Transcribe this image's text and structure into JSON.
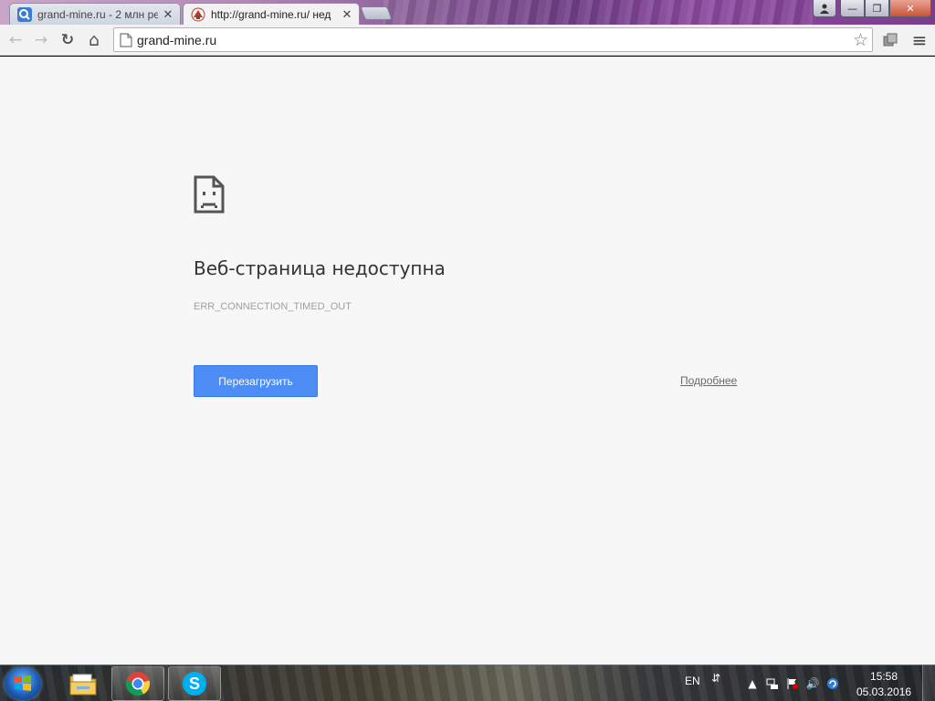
{
  "browser": {
    "tabs": [
      {
        "title": "grand-mine.ru - 2 млн рез",
        "close_label": "✕",
        "favicon": "search-icon",
        "active": false
      },
      {
        "title": "http://grand-mine.ru/ нед",
        "close_label": "✕",
        "favicon": "site-favicon",
        "active": true
      }
    ],
    "window_controls": {
      "minimize": "—",
      "maximize": "❐",
      "close": "✕"
    },
    "toolbar": {
      "back_icon": "←",
      "forward_icon": "→",
      "reload_icon": "↻",
      "home_icon": "⌂",
      "address": "grand-mine.ru",
      "bookmark_icon": "☆",
      "menu_icon": "≡"
    }
  },
  "error_page": {
    "icon": "sad-document-icon",
    "heading": "Веб-страница недоступна",
    "error_code": "ERR_CONNECTION_TIMED_OUT",
    "reload_button": "Перезагрузить",
    "details_link": "Подробнее",
    "accent_color": "#4d8cf5"
  },
  "taskbar": {
    "pinned": [
      "explorer-icon",
      "chrome-icon",
      "skype-icon"
    ],
    "tray": {
      "language": "EN",
      "time": "15:58",
      "date": "05.03.2016"
    }
  }
}
